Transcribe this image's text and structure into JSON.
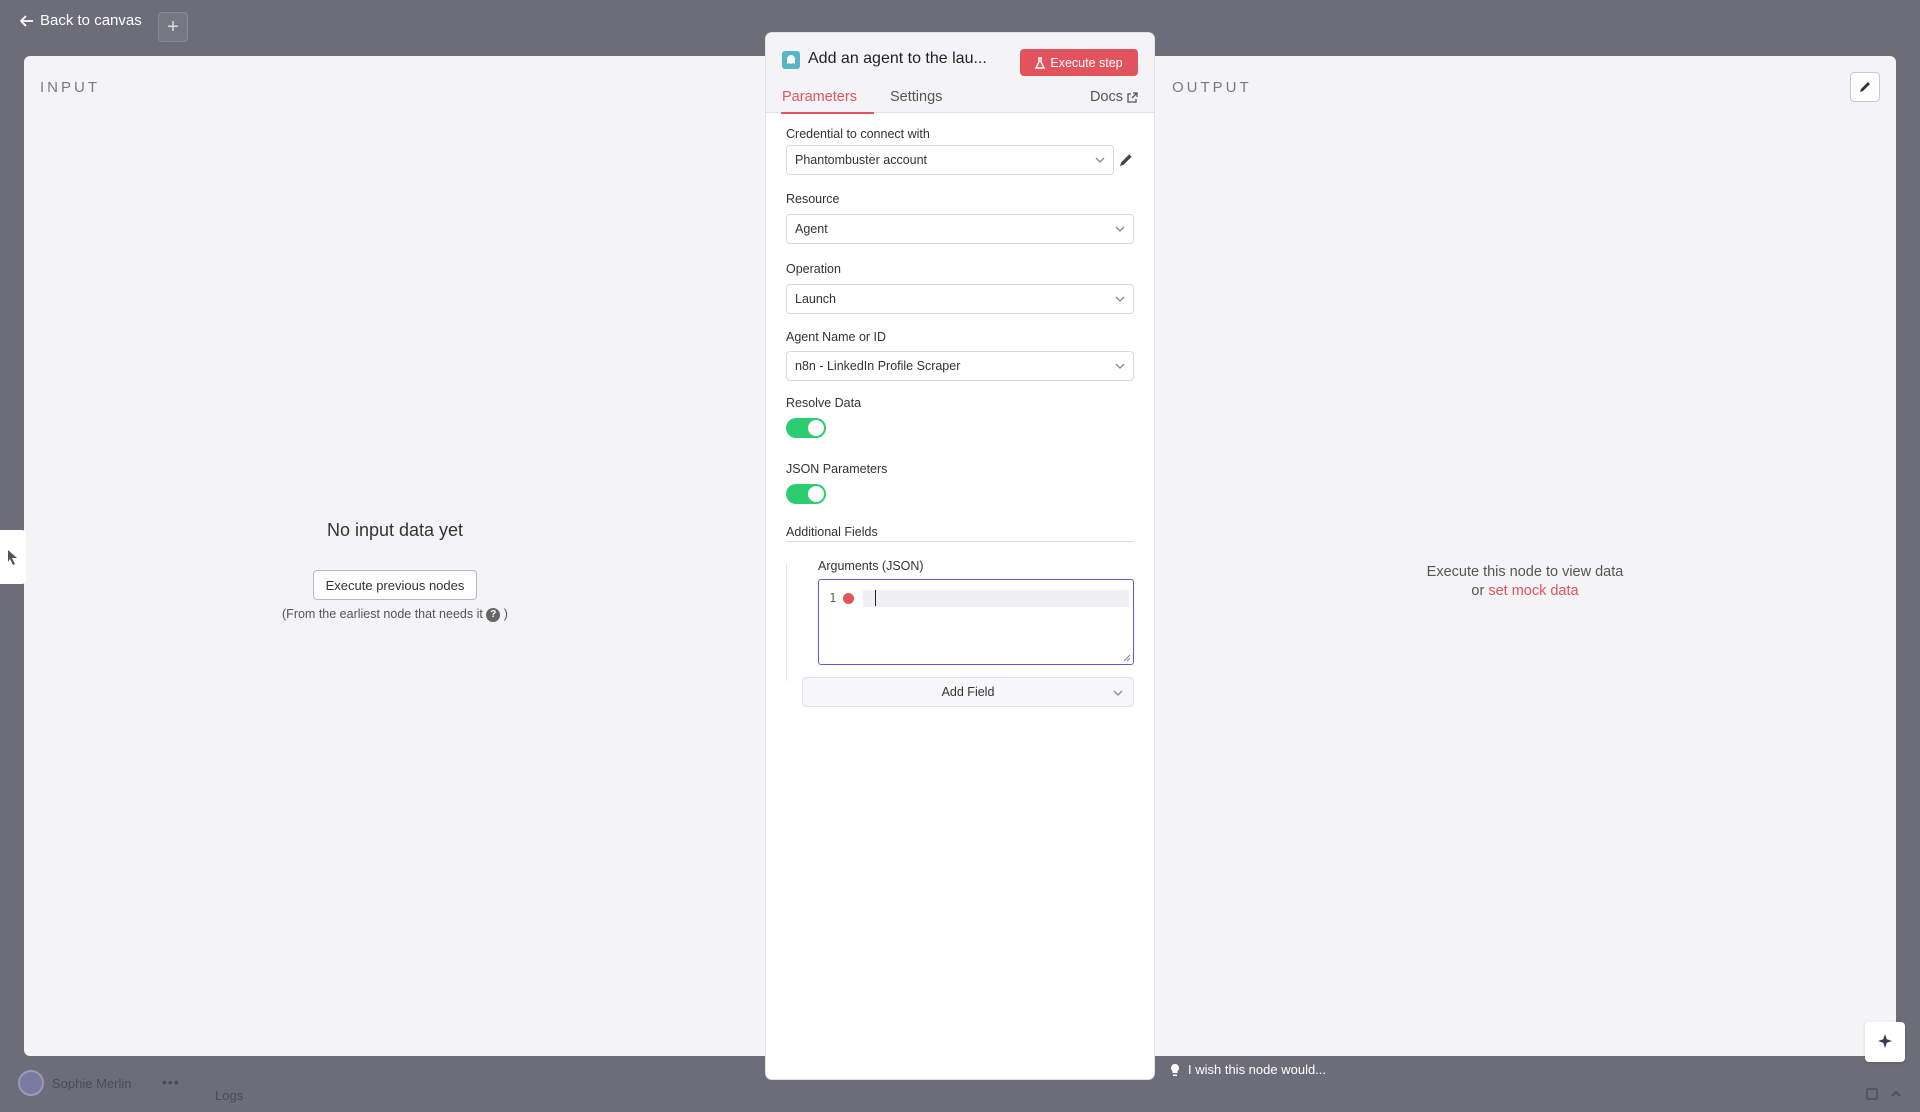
{
  "topbar": {
    "back_label": "Back to canvas"
  },
  "input_panel": {
    "label": "INPUT",
    "empty_title": "No input data yet",
    "execute_previous_label": "Execute previous nodes",
    "hint_before": "(From the earliest node that needs it",
    "hint_after": ")",
    "help_glyph": "?"
  },
  "output_panel": {
    "label": "OUTPUT",
    "message_line1": "Execute this node to view data",
    "message_or": "or",
    "mock_link": "set mock data"
  },
  "node": {
    "title": "Add an agent to the lau...",
    "execute_step_label": "Execute step",
    "tabs": [
      {
        "label": "Parameters",
        "active": true
      },
      {
        "label": "Settings",
        "active": false
      }
    ],
    "docs_label": "Docs",
    "fields": {
      "credential": {
        "label": "Credential to connect with",
        "value": "Phantombuster account"
      },
      "resource": {
        "label": "Resource",
        "value": "Agent"
      },
      "operation": {
        "label": "Operation",
        "value": "Launch"
      },
      "agent": {
        "label": "Agent Name or ID",
        "value": "n8n - LinkedIn Profile Scraper"
      },
      "resolve_data": {
        "label": "Resolve Data",
        "on": true
      },
      "json_parameters": {
        "label": "JSON Parameters",
        "on": true
      }
    },
    "additional_fields": {
      "label": "Additional Fields",
      "arguments_label": "Arguments (JSON)",
      "line_number": "1",
      "add_field_label": "Add Field"
    }
  },
  "footer": {
    "user_name": "Sophie Merlin",
    "more": "•••",
    "logs_label": "Logs",
    "feedback": "I wish this node would..."
  },
  "colors": {
    "accent": "#e1545d",
    "toggle_on": "#2ecc71",
    "backdrop": "#6d6d7a"
  }
}
